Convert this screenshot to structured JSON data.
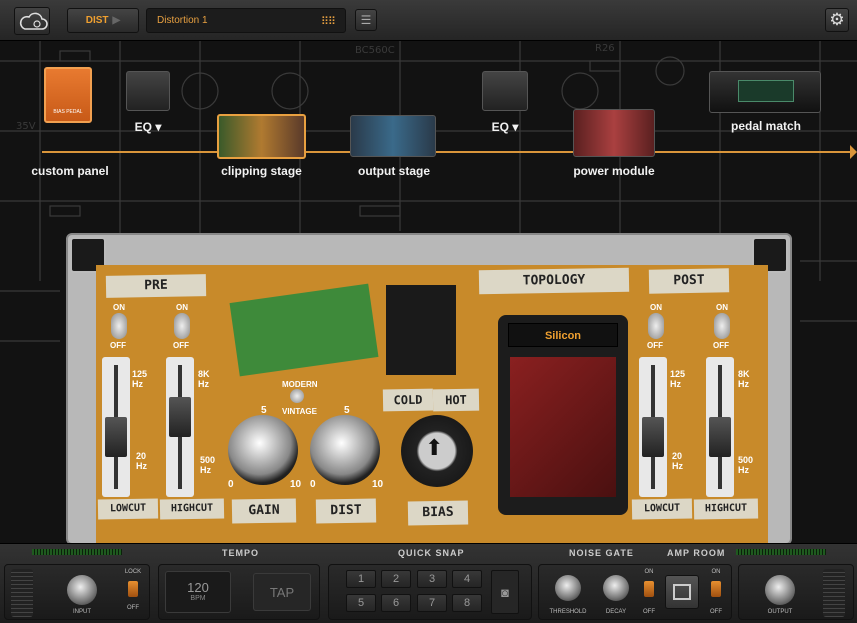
{
  "topbar": {
    "mode_label": "DIST",
    "preset_name": "Distortion 1",
    "preset_grid_icon": "grid-icon",
    "menu_icon": "hamburger-icon",
    "settings_icon": "gear-icon",
    "cloud_icon": "cloud-icon"
  },
  "chain": {
    "items": [
      {
        "label": "custom panel"
      },
      {
        "label": "EQ ▾"
      },
      {
        "label": "clipping stage"
      },
      {
        "label": "output stage"
      },
      {
        "label": "EQ ▾"
      },
      {
        "label": "power module"
      },
      {
        "label": "pedal match"
      }
    ],
    "pedal_text": "BIAS PEDAL"
  },
  "pedal": {
    "pre_label": "PRE",
    "post_label": "POST",
    "topology_label": "TOPOLOGY",
    "topology_value": "Silicon",
    "on": "ON",
    "off": "OFF",
    "pre_lowcut_top": "125 Hz",
    "pre_lowcut_bottom": "20 Hz",
    "pre_highcut_top": "8K Hz",
    "pre_highcut_bottom": "500 Hz",
    "post_lowcut_top": "125 Hz",
    "post_lowcut_bottom": "20 Hz",
    "post_highcut_top": "8K Hz",
    "post_highcut_bottom": "500 Hz",
    "lowcut": "LOWCUT",
    "highcut": "HIGHCUT",
    "modern": "MODERN",
    "vintage": "VINTAGE",
    "gain": "GAIN",
    "dist": "DIST",
    "bias": "BIAS",
    "cold": "COLD",
    "hot": "HOT",
    "gain_min": "0",
    "gain_mid": "5",
    "gain_max": "10",
    "dist_min": "0",
    "dist_mid": "5",
    "dist_max": "10"
  },
  "bottom": {
    "tempo_title": "TEMPO",
    "quick_snap_title": "QUICK SNAP",
    "noise_gate_title": "NOISE GATE",
    "amp_room_title": "AMP ROOM",
    "input_label": "INPUT",
    "lock_label": "LOCK",
    "lock_off": "OFF",
    "bpm_value": "120",
    "bpm_unit": "BPM",
    "tap_label": "TAP",
    "snaps": [
      "1",
      "2",
      "3",
      "4",
      "5",
      "6",
      "7",
      "8"
    ],
    "camera_icon": "camera-icon",
    "threshold_label": "THRESHOLD",
    "decay_label": "DECAY",
    "gate_on": "ON",
    "gate_off": "OFF",
    "room_on": "ON",
    "room_off": "OFF",
    "output_label": "OUTPUT"
  }
}
